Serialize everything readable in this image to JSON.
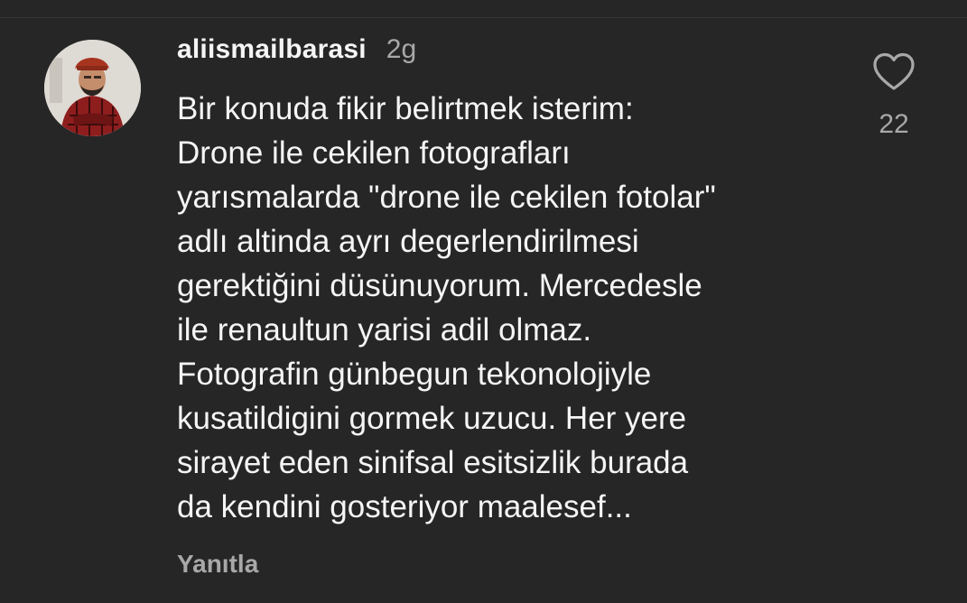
{
  "comment": {
    "username": "aliismailbarasi",
    "timestamp": "2g",
    "text_lines": [
      "Bir konuda fikir belirtmek isterim:",
      "Drone ile cekilen fotografları",
      "yarısmalarda \"drone ile cekilen fotolar\"",
      "adlı altinda ayrı degerlendirilmesi",
      "gerektiğini düsünuyorum. Mercedesle",
      "ile renaultun yarisi adil olmaz.",
      "Fotografin günbegun tekonolojiyle",
      "kusatildigini gormek uzucu. Her yere",
      "sirayet eden sinifsal esitsizlik burada",
      "da kendini gosteriyor maalesef..."
    ],
    "reply_label": "Yanıtla",
    "like_count": "22"
  },
  "icons": {
    "like": "heart-outline-icon"
  },
  "colors": {
    "background": "#262626",
    "primary_text": "#f5f5f5",
    "secondary_text": "#a8a8a8"
  }
}
